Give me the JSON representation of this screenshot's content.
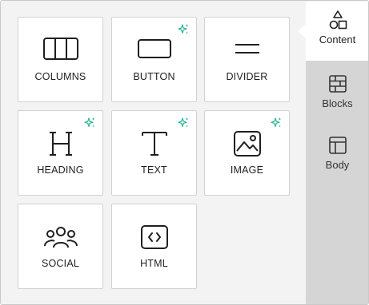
{
  "tiles": [
    {
      "label": "COLUMNS",
      "icon": "columns-icon",
      "ai": false
    },
    {
      "label": "BUTTON",
      "icon": "button-icon",
      "ai": true
    },
    {
      "label": "DIVIDER",
      "icon": "divider-icon",
      "ai": false
    },
    {
      "label": "HEADING",
      "icon": "heading-icon",
      "ai": true
    },
    {
      "label": "TEXT",
      "icon": "text-icon",
      "ai": true
    },
    {
      "label": "IMAGE",
      "icon": "image-icon",
      "ai": true
    },
    {
      "label": "SOCIAL",
      "icon": "social-icon",
      "ai": false
    },
    {
      "label": "HTML",
      "icon": "html-code-icon",
      "ai": false
    }
  ],
  "sidebar": {
    "tabs": [
      {
        "label": "Content",
        "icon": "shapes-icon",
        "active": true
      },
      {
        "label": "Blocks",
        "icon": "blocks-grid-icon",
        "active": false
      },
      {
        "label": "Body",
        "icon": "layout-icon",
        "active": false
      }
    ]
  },
  "colors": {
    "ai_sparkle": "#2bb39a",
    "sidebar_bg": "#d5d5d5",
    "canvas_bg": "#f3f3f3",
    "tile_border": "#d2d2d2"
  }
}
